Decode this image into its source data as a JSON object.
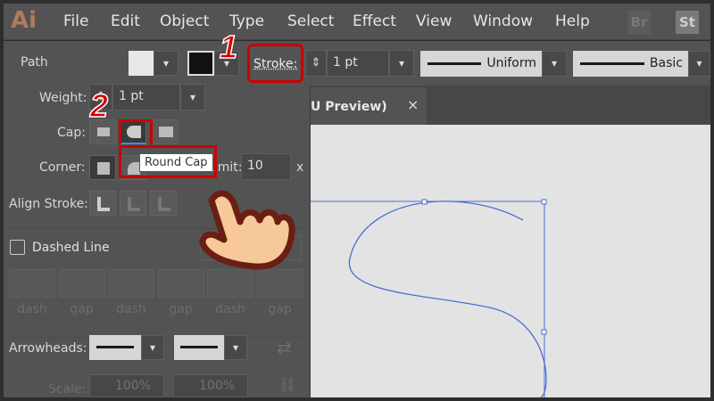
{
  "menubar": {
    "logo": "Ai",
    "items": [
      "File",
      "Edit",
      "Object",
      "Type",
      "Select",
      "Effect",
      "View",
      "Window",
      "Help"
    ],
    "bridge": "Br",
    "stock": "St"
  },
  "control": {
    "selection": "Path",
    "stroke_label": "Stroke:",
    "weight": "1 pt",
    "profile": "Uniform",
    "brush": "Basic"
  },
  "annotations": {
    "step1": "1",
    "step2": "2"
  },
  "document_tab": {
    "title": "U Preview)",
    "close": "×"
  },
  "stroke_panel": {
    "weight_label": "Weight:",
    "weight_value": "1 pt",
    "cap_label": "Cap:",
    "corner_label": "Corner:",
    "limit_label": "Limit:",
    "limit_value": "10",
    "limit_unit": "x",
    "align_label": "Align Stroke:",
    "dashed_label": "Dashed Line",
    "dash_labels": [
      "dash",
      "gap",
      "dash",
      "gap",
      "dash",
      "gap"
    ],
    "arrowheads_label": "Arrowheads:",
    "scale_label": "Scale:",
    "scale_start": "100%",
    "scale_end": "100%"
  },
  "tooltip": "Round Cap",
  "colors": {
    "accent": "#cc0000",
    "path": "#4a6fd1"
  }
}
